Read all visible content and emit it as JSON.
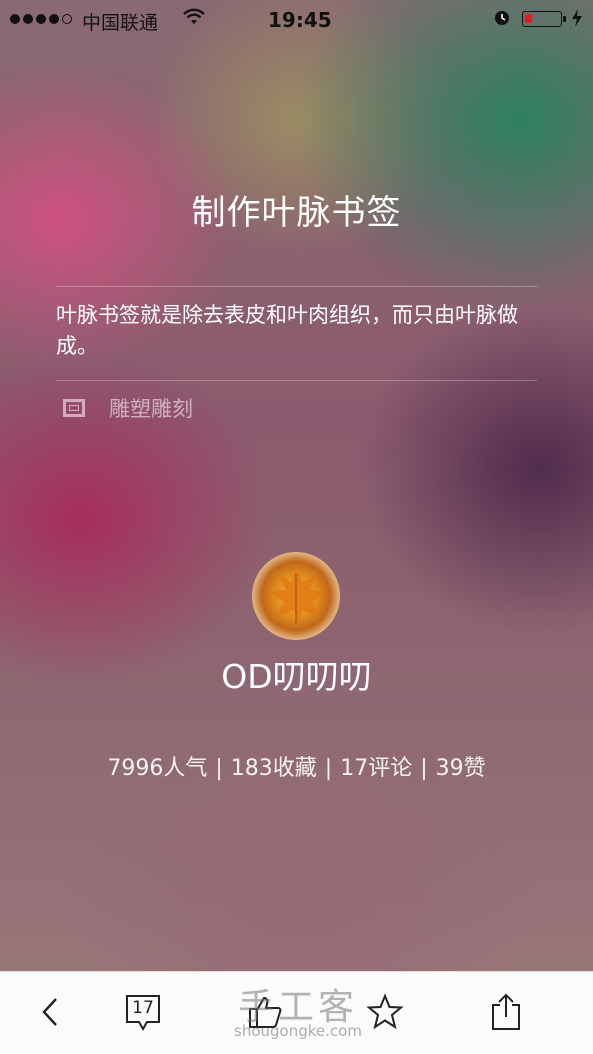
{
  "status_bar": {
    "carrier": "中国联通",
    "time": "19:45",
    "battery_level": 0.2
  },
  "project": {
    "title": "制作叶脉书签",
    "description": "叶脉书签就是除去表皮和叶肉组织，而只由叶脉做成。",
    "category": "雕塑雕刻"
  },
  "author": {
    "name": "OD叨叨叨"
  },
  "stats": {
    "popularity": "7996人气",
    "favorites": "183收藏",
    "comments": "17评论",
    "likes": "39赞"
  },
  "toolbar": {
    "comment_count": "17"
  },
  "watermark": {
    "logo": "手工客",
    "site": "shougongke.com"
  },
  "colors": {
    "battery_low": "#e02020",
    "toolbar_bg": "#fbfbfb"
  }
}
